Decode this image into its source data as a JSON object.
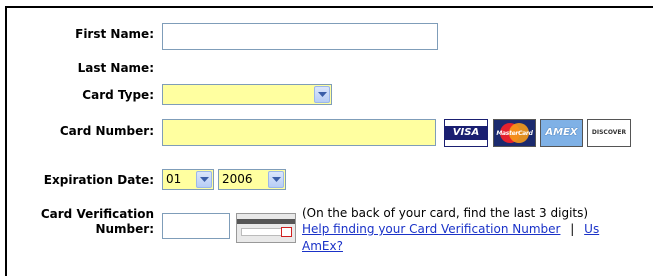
{
  "form": {
    "first_name": {
      "label": "First Name:",
      "value": ""
    },
    "last_name": {
      "label": "Last Name:"
    },
    "card_type": {
      "label": "Card Type:",
      "selected": ""
    },
    "card_number": {
      "label": "Card Number:",
      "value": ""
    },
    "card_logos": [
      "VISA",
      "MasterCard",
      "AMEX",
      "DISCOVER"
    ],
    "expiration": {
      "label": "Expiration Date:",
      "month": "01",
      "year": "2006"
    },
    "cvv": {
      "label_line1": "Card Verification",
      "label_line2": "Number:",
      "value": "",
      "hint": "(On the back of your card, find the last 3 digits)",
      "help_link": "Help finding your Card Verification Number",
      "separator": "|",
      "link_fragment": "Us",
      "amex_link": "AmEx?"
    }
  },
  "colors": {
    "required_field": "#ffffa0",
    "link": "#1a32c8",
    "border": "#7f9db9"
  }
}
